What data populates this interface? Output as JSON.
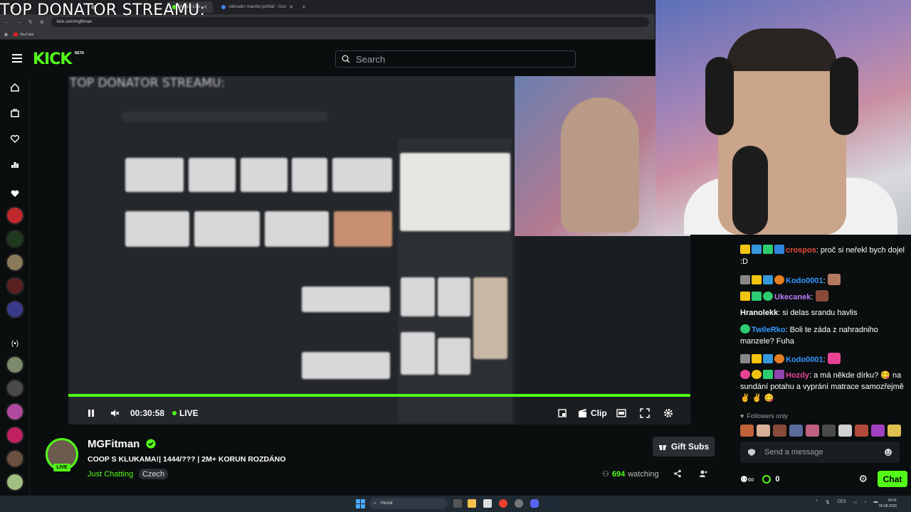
{
  "overlay_title": "TOP DONATOR STREAMU:",
  "browser": {
    "tabs": [
      {
        "label": "Watch Live",
        "active": true
      },
      {
        "label": "náhradní manžel polštář - Goo",
        "active": false
      }
    ],
    "new_tab": "+",
    "url": "kick.com/mgfitman",
    "bookmark": "YouTube"
  },
  "header": {
    "logo": "KICK",
    "beta": "BETA",
    "search_placeholder": "Search"
  },
  "video": {
    "inner_title": "TOP DONATOR STREAMU:",
    "progress": 1.0,
    "time": "00:30:58",
    "live_label": "LIVE",
    "clip_label": "Clip"
  },
  "stream": {
    "live_tag": "LIVE",
    "streamer": "MGFitman",
    "title": "COOP S KLUKAMA!| 1444/??? | 2M+ KORUN ROZDÁNO",
    "category": "Just Chatting",
    "language": "Czech",
    "gift_label": "Gift Subs",
    "viewers": "694",
    "watching_label": "watching"
  },
  "chat": {
    "messages": [
      {
        "user": "crospos",
        "user_color": "#e74c3c",
        "text": ": proč si neřekl bych dojel :D"
      },
      {
        "user": "Kodo0001",
        "user_color": "#3498ff",
        "text": ":"
      },
      {
        "user": "Ukecanek",
        "user_color": "#b97cf6",
        "text": ":"
      },
      {
        "user": "Hranolekk",
        "user_color": "#ffffff",
        "text": ": si delas srandu havlis"
      },
      {
        "user": "TwileRko",
        "user_color": "#3498ff",
        "text": ": Boli te záda z nahradniho manzele? Fuha"
      },
      {
        "user": "Kodo0001",
        "user_color": "#3498ff",
        "text": ":"
      },
      {
        "user": "Hozdy",
        "user_color": "#e84393",
        "text": ": a má někde dírku? 😋 na sundání potahu a vyprání matrace samozřejmě ✌️ ✌️ 😋"
      }
    ],
    "followers_label": "Followers only",
    "input_placeholder": "Send a message",
    "points": "0",
    "chat_button": "Chat"
  },
  "taskbar": {
    "search_placeholder": "Hledat",
    "language": "CES",
    "time": "18:41",
    "date": "06.08.2026"
  },
  "colors": {
    "accent": "#53fc18",
    "background": "#0b0e0f"
  }
}
